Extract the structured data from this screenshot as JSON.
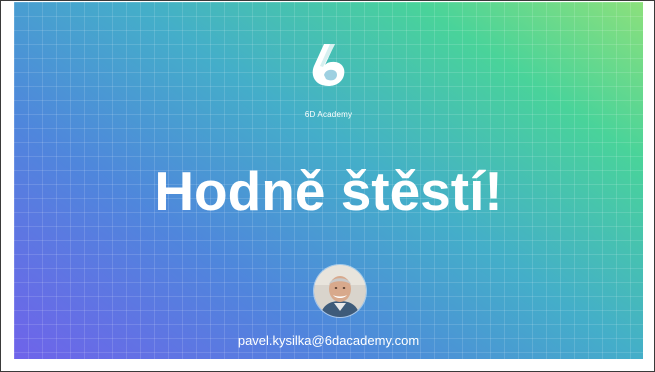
{
  "slide": {
    "brand_name": "6D Academy",
    "logo_icon": "6d-academy-logo",
    "headline": "Hodně štěstí!",
    "avatar_icon": "presenter-photo",
    "email": "pavel.kysilka@6dacademy.com"
  },
  "colors": {
    "gradient_start": "#6f63ea",
    "gradient_end": "#8ce07c",
    "text": "#ffffff"
  }
}
